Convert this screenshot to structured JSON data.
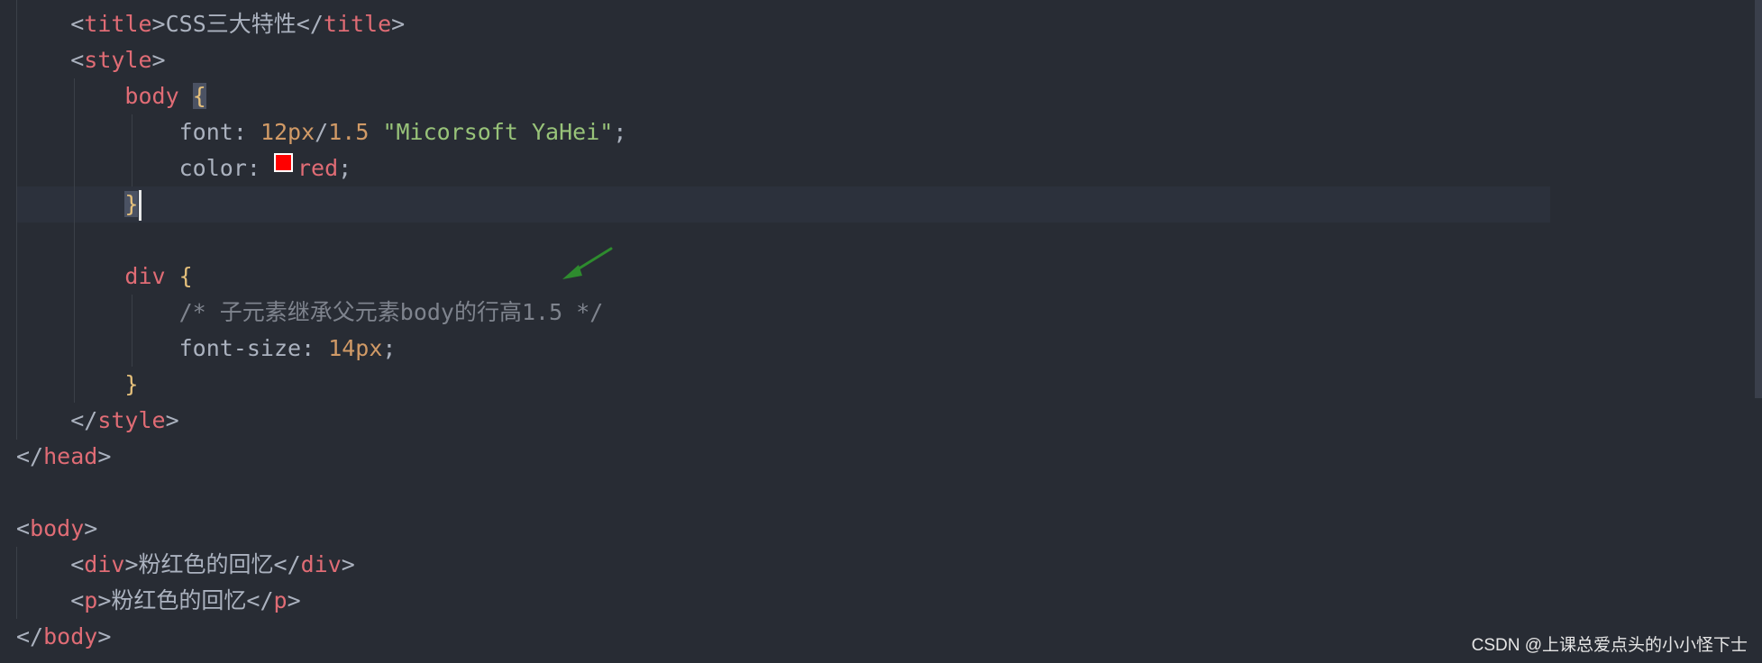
{
  "code": {
    "line1": {
      "indent": "    ",
      "lt": "<",
      "tag": "title",
      "gt": ">",
      "text": "CSS三大特性",
      "close_lt": "</",
      "close_tag": "title",
      "close_gt": ">"
    },
    "line2": {
      "indent": "    ",
      "lt": "<",
      "tag": "style",
      "gt": ">"
    },
    "line3": {
      "indent": "        ",
      "selector": "body",
      "space": " ",
      "brace": "{"
    },
    "line4": {
      "indent": "            ",
      "prop": "font: ",
      "size": "12px",
      "slash": "/",
      "lh": "1.5",
      "space": " ",
      "str": "\"Micorsoft YaHei\"",
      "semi": ";"
    },
    "line5": {
      "indent": "            ",
      "prop": "color: ",
      "value": "red",
      "semi": ";"
    },
    "line6": {
      "indent": "        ",
      "brace": "}"
    },
    "line8": {
      "indent": "        ",
      "selector": "div",
      "space": " ",
      "brace": "{"
    },
    "line9": {
      "indent": "            ",
      "comment": "/* 子元素继承父元素body的行高1.5 */"
    },
    "line10": {
      "indent": "            ",
      "prop": "font-size: ",
      "value": "14px",
      "semi": ";"
    },
    "line11": {
      "indent": "        ",
      "brace": "}"
    },
    "line12": {
      "indent": "    ",
      "lt": "</",
      "tag": "style",
      "gt": ">"
    },
    "line13": {
      "lt": "</",
      "tag": "head",
      "gt": ">"
    },
    "line15": {
      "lt": "<",
      "tag": "body",
      "gt": ">"
    },
    "line16": {
      "indent": "    ",
      "lt": "<",
      "tag": "div",
      "gt": ">",
      "text": "粉红色的回忆",
      "close_lt": "</",
      "close_tag": "div",
      "close_gt": ">"
    },
    "line17": {
      "indent": "    ",
      "lt": "<",
      "tag": "p",
      "gt": ">",
      "text": "粉红色的回忆",
      "close_lt": "</",
      "close_tag": "p",
      "close_gt": ">"
    },
    "line18": {
      "lt": "</",
      "tag": "body",
      "gt": ">"
    }
  },
  "colors": {
    "swatch": "#ff0000",
    "arrow": "#2e8b2e",
    "background": "#282c34"
  },
  "watermark": "CSDN @上课总爱点头的小小怪下士"
}
